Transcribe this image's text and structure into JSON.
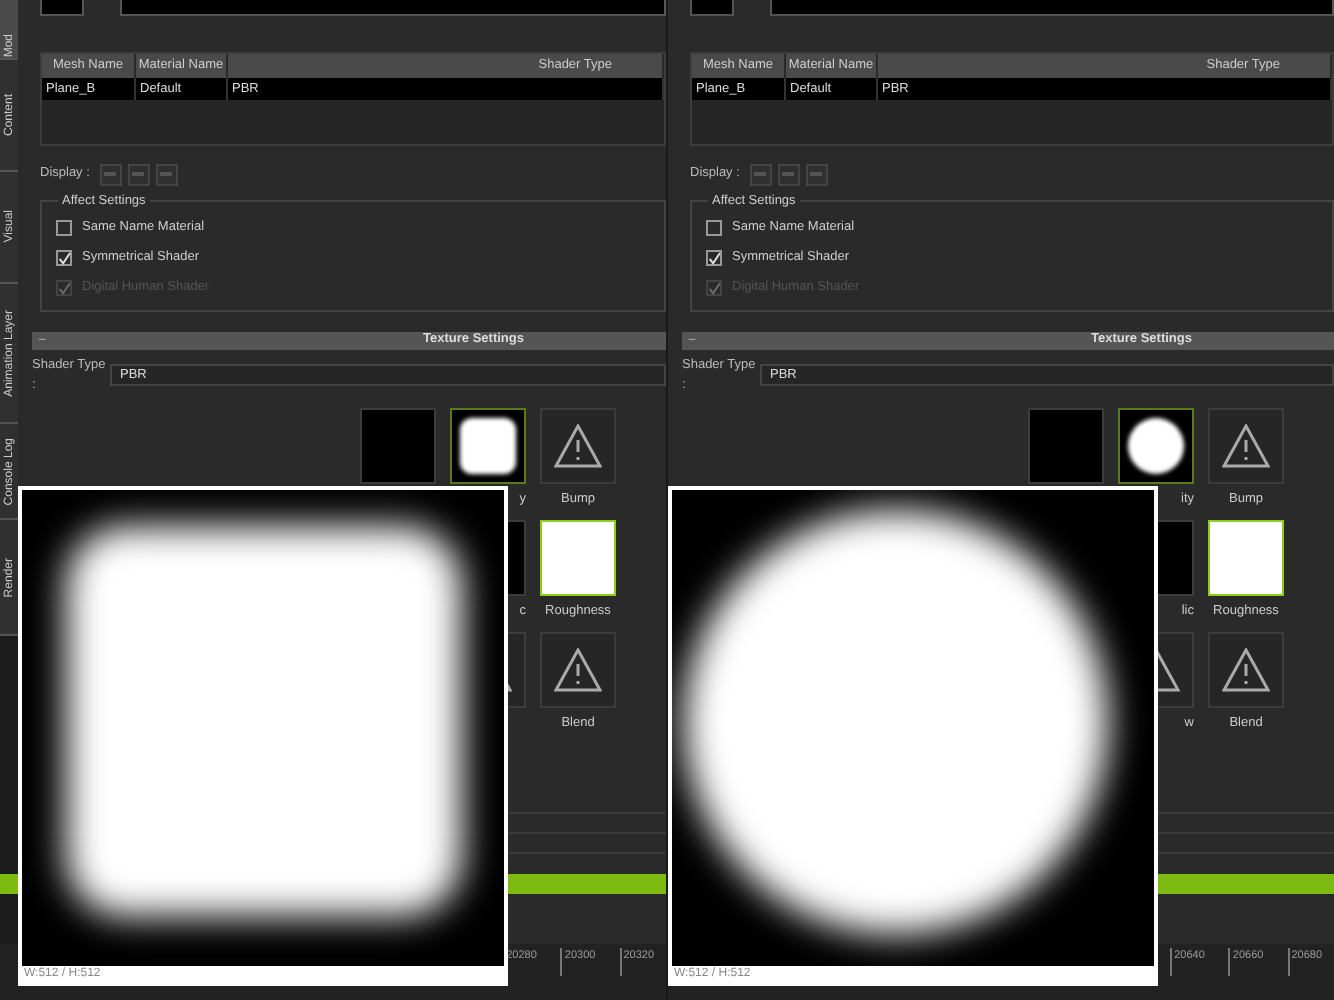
{
  "panels": [
    {
      "side_tabs": [
        {
          "label": "Mod",
          "selected": true
        },
        {
          "label": "Content",
          "selected": false
        },
        {
          "label": "Visual",
          "selected": false
        },
        {
          "label": "Animation Layer",
          "selected": false
        },
        {
          "label": "Console Log",
          "selected": false
        },
        {
          "label": "Render",
          "selected": false
        }
      ],
      "table": {
        "columns": [
          "Mesh Name",
          "Material Name",
          "Shader Type"
        ],
        "rows": [
          [
            "Plane_B",
            "Default",
            "PBR"
          ]
        ]
      },
      "display_label": "Display :",
      "affect_settings": {
        "title": "Affect Settings",
        "options": [
          {
            "label": "Same Name Material",
            "checked": false,
            "disabled": false
          },
          {
            "label": "Symmetrical Shader",
            "checked": true,
            "disabled": false
          },
          {
            "label": "Digital Human Shader",
            "checked": true,
            "disabled": true
          }
        ]
      },
      "texture_settings": {
        "collapse": "−",
        "title": "Texture Settings"
      },
      "shader_type": {
        "label": "Shader Type :",
        "value": "PBR"
      },
      "thumbnails": [
        [
          {
            "kind": "black",
            "selected": false
          },
          {
            "kind": "rounded",
            "label": "y",
            "selected": true
          },
          {
            "kind": "warning",
            "label": "Bump",
            "selected": false
          }
        ],
        [
          {
            "kind": "black",
            "label": "c",
            "selected": false
          },
          {
            "kind": "white",
            "label": "Roughness",
            "selected": true
          }
        ],
        [
          {
            "kind": "warning",
            "selected": false
          },
          {
            "kind": "warning",
            "label": "Blend",
            "selected": false
          }
        ]
      ],
      "timeline_ticks": [
        "20280",
        "20300",
        "20320"
      ],
      "preview": {
        "kind": "rounded",
        "caption": "W:512 / H:512"
      }
    },
    {
      "table": {
        "columns": [
          "Mesh Name",
          "Material Name",
          "Shader Type"
        ],
        "rows": [
          [
            "Plane_B",
            "Default",
            "PBR"
          ]
        ]
      },
      "display_label": "Display :",
      "affect_settings": {
        "title": "Affect Settings",
        "options": [
          {
            "label": "Same Name Material",
            "checked": false,
            "disabled": false
          },
          {
            "label": "Symmetrical Shader",
            "checked": true,
            "disabled": false
          },
          {
            "label": "Digital Human Shader",
            "checked": true,
            "disabled": true
          }
        ]
      },
      "texture_settings": {
        "collapse": "−",
        "title": "Texture Settings"
      },
      "shader_type": {
        "label": "Shader Type :",
        "value": "PBR"
      },
      "thumbnails": [
        [
          {
            "kind": "black",
            "selected": false
          },
          {
            "kind": "circle",
            "label": "ity",
            "selected": true
          },
          {
            "kind": "warning",
            "label": "Bump",
            "selected": false
          }
        ],
        [
          {
            "kind": "black",
            "label": "lic",
            "selected": false
          },
          {
            "kind": "white",
            "label": "Roughness",
            "selected": true
          }
        ],
        [
          {
            "kind": "warning",
            "label": "w",
            "selected": false
          },
          {
            "kind": "warning",
            "label": "Blend",
            "selected": false
          }
        ]
      ],
      "timeline_ticks": [
        "20640",
        "20660",
        "20680"
      ],
      "preview": {
        "kind": "circle",
        "caption": "W:512 / H:512"
      }
    }
  ]
}
